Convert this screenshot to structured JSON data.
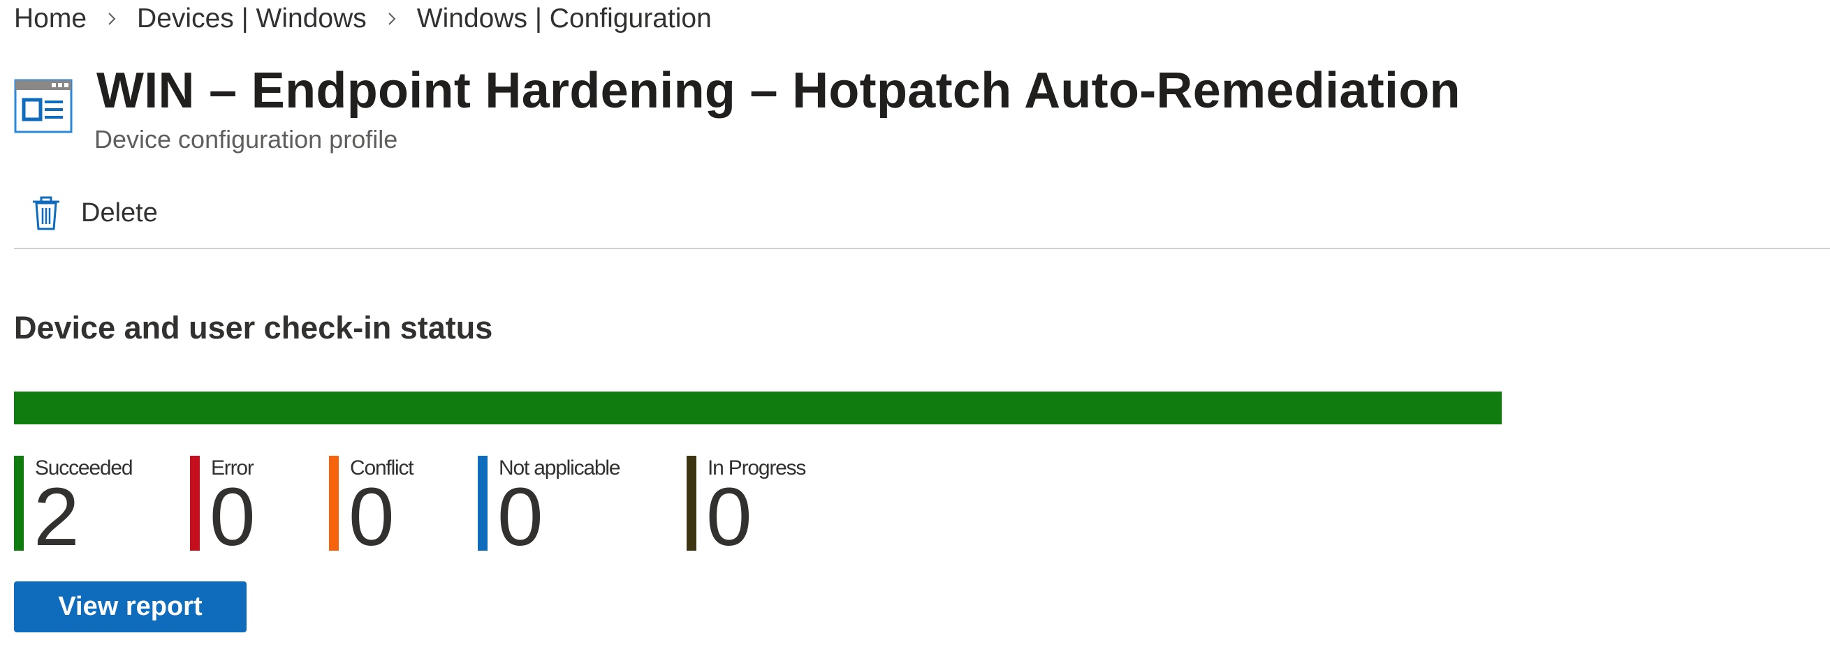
{
  "breadcrumb": {
    "items": [
      "Home",
      "Devices | Windows",
      "Windows | Configuration"
    ]
  },
  "header": {
    "title": "WIN – Endpoint Hardening – Hotpatch Auto-Remediation",
    "subtitle": "Device configuration profile",
    "icon": "configuration-profile-icon"
  },
  "toolbar": {
    "delete_label": "Delete",
    "delete_icon": "trash-icon"
  },
  "checkin": {
    "title": "Device and user check-in status",
    "legend": [
      {
        "label": "Succeeded",
        "value": "2",
        "color": "#107c10"
      },
      {
        "label": "Error",
        "value": "0",
        "color": "#c50f1f"
      },
      {
        "label": "Conflict",
        "value": "0",
        "color": "#f7630c"
      },
      {
        "label": "Not applicable",
        "value": "0",
        "color": "#0f6cbd"
      },
      {
        "label": "In Progress",
        "value": "0",
        "color": "#3d3411"
      }
    ],
    "view_report_label": "View report"
  },
  "colors": {
    "accent": "#0f6cbd",
    "succeeded": "#107c10"
  }
}
